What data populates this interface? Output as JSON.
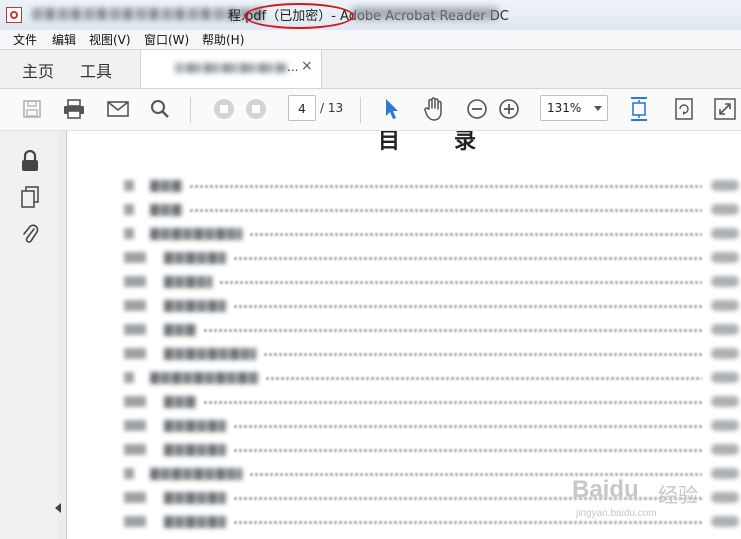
{
  "window": {
    "title_suffix": "程.pdf（已加密）- Adobe Acrobat Reader DC"
  },
  "menu": [
    {
      "label": "文件"
    },
    {
      "label": "编辑"
    },
    {
      "label": "视图(V)"
    },
    {
      "label": "窗口(W)"
    },
    {
      "label": "帮助(H)"
    }
  ],
  "tabs": {
    "home": "主页",
    "tools": "工具",
    "doc_suffix": "...",
    "close": "×"
  },
  "toolbar": {
    "page_current": "4",
    "page_total": "/ 13",
    "zoom": "131%",
    "icons": [
      "save-icon",
      "print-icon",
      "email-icon",
      "search-icon",
      "prev-page-icon",
      "next-page-icon",
      "select-cursor-icon",
      "hand-tool-icon",
      "zoom-out-icon",
      "zoom-in-icon",
      "fit-page-icon",
      "rotate-icon",
      "fullscreen-icon"
    ]
  },
  "left_panel": {
    "icons": [
      "lock-icon",
      "attachments-pages-icon",
      "paperclip-icon"
    ]
  },
  "document": {
    "title": "目录"
  },
  "watermark": {
    "text": "Baidu",
    "cn": "经验",
    "url": "jingyan.baidu.com"
  },
  "colors": {
    "annotation_red": "#d0181f",
    "accent_blue": "#2b7bd6"
  }
}
